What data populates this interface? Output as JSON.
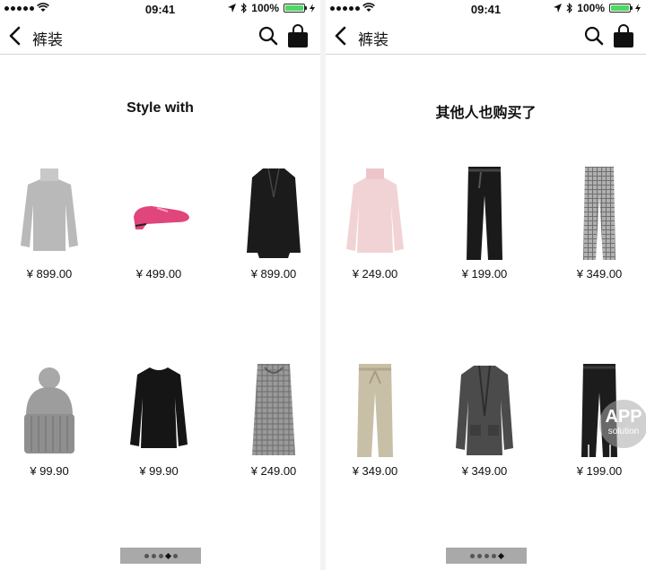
{
  "left_screen": {
    "status": {
      "time": "09:41",
      "battery": "100%",
      "battery_level": 1.0
    },
    "nav": {
      "title": "裤装",
      "back": "chevron-left-icon",
      "search": "search-icon",
      "cart": "shopping-bag-icon"
    },
    "section_title": "Style with",
    "products": [
      {
        "name": "gray-turtleneck-sweater",
        "price": "¥ 899.00"
      },
      {
        "name": "pink-metallic-loafer",
        "price": "¥ 499.00"
      },
      {
        "name": "black-coat",
        "price": "¥ 899.00"
      },
      {
        "name": "gray-knit-beanie",
        "price": "¥ 99.90"
      },
      {
        "name": "black-blouse",
        "price": "¥ 99.90"
      },
      {
        "name": "plaid-pencil-skirt",
        "price": "¥ 249.00"
      }
    ],
    "pager": {
      "count": 5,
      "active": 4
    }
  },
  "right_screen": {
    "status": {
      "time": "09:41",
      "battery": "100%",
      "battery_level": 1.0
    },
    "nav": {
      "title": "裤装",
      "back": "chevron-left-icon",
      "search": "search-icon",
      "cart": "shopping-bag-icon"
    },
    "section_title": "其他人也购买了",
    "products": [
      {
        "name": "pink-knit-sweater",
        "price": "¥ 249.00"
      },
      {
        "name": "black-belted-trousers",
        "price": "¥ 199.00"
      },
      {
        "name": "houndstooth-trousers",
        "price": "¥ 349.00"
      },
      {
        "name": "beige-paperbag-trousers",
        "price": "¥ 349.00"
      },
      {
        "name": "gray-knit-cardigan",
        "price": "¥ 349.00"
      },
      {
        "name": "black-slit-trousers",
        "price": "¥ 199.00"
      }
    ],
    "pager": {
      "count": 5,
      "active": 5
    }
  },
  "watermark": {
    "line1": "APP",
    "line2": "solution"
  },
  "colors": {
    "battery": "#4cd964",
    "divider": "#d6d6d6",
    "pager_bg": "#a9a9a9"
  }
}
